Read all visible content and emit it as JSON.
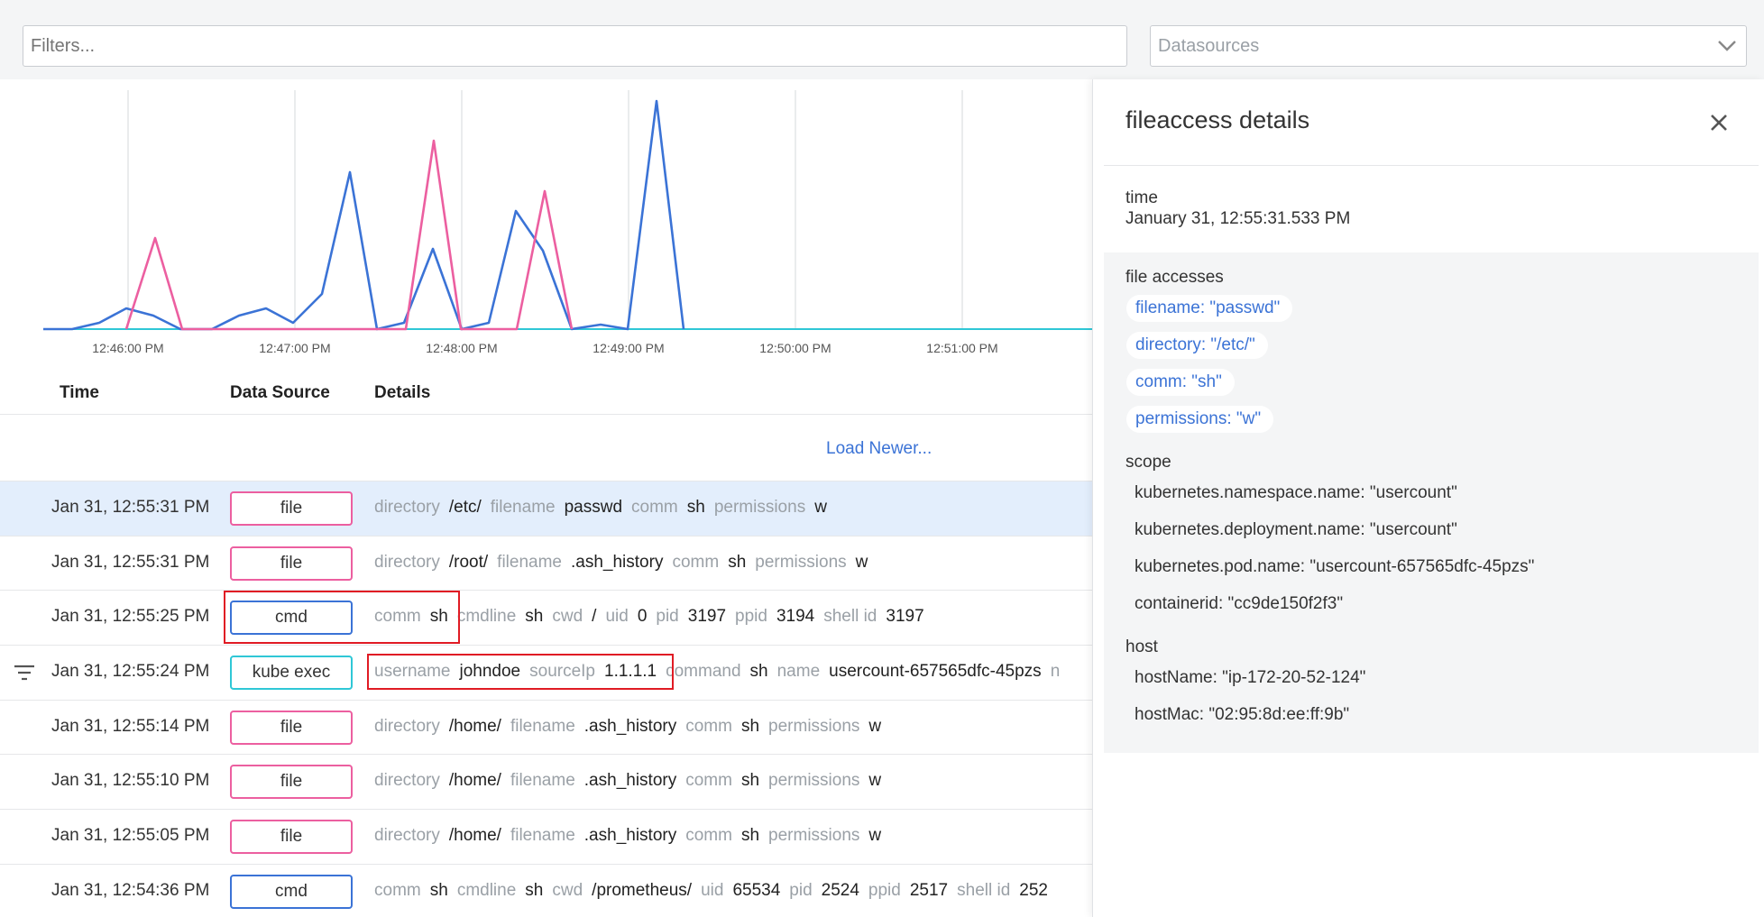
{
  "filters": {
    "placeholder": "Filters..."
  },
  "datasources": {
    "placeholder": "Datasources"
  },
  "chart": {
    "x_ticks": [
      "12:46:00 PM",
      "12:47:00 PM",
      "12:48:00 PM",
      "12:49:00 PM",
      "12:50:00 PM",
      "12:51:00 PM"
    ],
    "series_colors": {
      "cmd": "#3b73d6",
      "file": "#ec5fa0",
      "kube": "#2fc7d6"
    }
  },
  "table": {
    "headers": {
      "time": "Time",
      "source": "Data Source",
      "details": "Details"
    },
    "load_newer": "Load Newer...",
    "rows": [
      {
        "time": "Jan 31, 12:55:31 PM",
        "source": "file",
        "details": [
          [
            "directory",
            "/etc/"
          ],
          [
            "filename",
            "passwd"
          ],
          [
            "comm",
            "sh"
          ],
          [
            "permissions",
            "w"
          ]
        ]
      },
      {
        "time": "Jan 31, 12:55:31 PM",
        "source": "file",
        "details": [
          [
            "directory",
            "/root/"
          ],
          [
            "filename",
            ".ash_history"
          ],
          [
            "comm",
            "sh"
          ],
          [
            "permissions",
            "w"
          ]
        ]
      },
      {
        "time": "Jan 31, 12:55:25 PM",
        "source": "cmd",
        "details": [
          [
            "comm",
            "sh"
          ],
          [
            "cmdline",
            "sh"
          ],
          [
            "cwd",
            "/"
          ],
          [
            "uid",
            "0"
          ],
          [
            "pid",
            "3197"
          ],
          [
            "ppid",
            "3194"
          ],
          [
            "shell id",
            "3197"
          ]
        ]
      },
      {
        "time": "Jan 31, 12:55:24 PM",
        "source": "kube exec",
        "details": [
          [
            "username",
            "johndoe"
          ],
          [
            "sourceIp",
            "1.1.1.1"
          ],
          [
            "command",
            "sh"
          ],
          [
            "name",
            "usercount-657565dfc-45pzs"
          ],
          [
            "n",
            ""
          ]
        ]
      },
      {
        "time": "Jan 31, 12:55:14 PM",
        "source": "file",
        "details": [
          [
            "directory",
            "/home/"
          ],
          [
            "filename",
            ".ash_history"
          ],
          [
            "comm",
            "sh"
          ],
          [
            "permissions",
            "w"
          ]
        ]
      },
      {
        "time": "Jan 31, 12:55:10 PM",
        "source": "file",
        "details": [
          [
            "directory",
            "/home/"
          ],
          [
            "filename",
            ".ash_history"
          ],
          [
            "comm",
            "sh"
          ],
          [
            "permissions",
            "w"
          ]
        ]
      },
      {
        "time": "Jan 31, 12:55:05 PM",
        "source": "file",
        "details": [
          [
            "directory",
            "/home/"
          ],
          [
            "filename",
            ".ash_history"
          ],
          [
            "comm",
            "sh"
          ],
          [
            "permissions",
            "w"
          ]
        ]
      },
      {
        "time": "Jan 31, 12:54:36 PM",
        "source": "cmd",
        "details": [
          [
            "comm",
            "sh"
          ],
          [
            "cmdline",
            "sh"
          ],
          [
            "cwd",
            "/prometheus/"
          ],
          [
            "uid",
            "65534"
          ],
          [
            "pid",
            "2524"
          ],
          [
            "ppid",
            "2517"
          ],
          [
            "shell id",
            "252"
          ]
        ]
      }
    ]
  },
  "panel": {
    "title": "fileaccess details",
    "time_label": "time",
    "time_value": "January 31, 12:55:31.533 PM",
    "file_accesses_label": "file accesses",
    "file_accesses": [
      "filename: \"passwd\"",
      "directory: \"/etc/\"",
      "comm: \"sh\"",
      "permissions: \"w\""
    ],
    "scope_label": "scope",
    "scope": [
      "kubernetes.namespace.name: \"usercount\"",
      "kubernetes.deployment.name: \"usercount\"",
      "kubernetes.pod.name: \"usercount-657565dfc-45pzs\"",
      "containerid: \"cc9de150f2f3\""
    ],
    "host_label": "host",
    "host": [
      "hostName: \"ip-172-20-52-124\"",
      "hostMac: \"02:95:8d:ee:ff:9b\""
    ]
  }
}
